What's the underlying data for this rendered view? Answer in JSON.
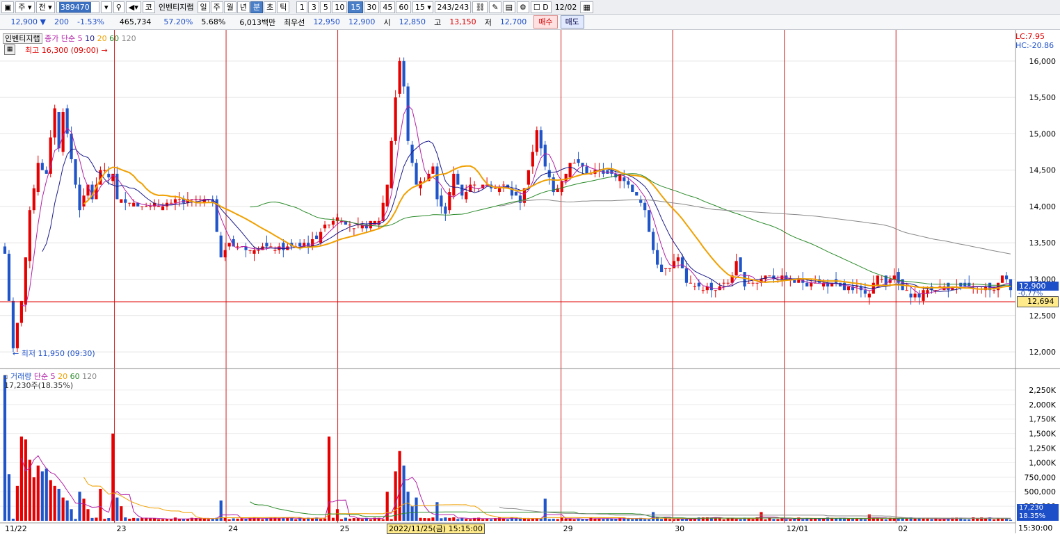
{
  "toolbar": {
    "period_prefix": "주",
    "mode": "전",
    "code": "389470",
    "market_badge": "코",
    "name": "인벤티지랩",
    "periods": [
      "일",
      "주",
      "월",
      "년",
      "분",
      "초",
      "틱"
    ],
    "active_period": "분",
    "intervals": [
      "1",
      "3",
      "5",
      "10",
      "15",
      "30",
      "45",
      "60"
    ],
    "active_interval": "15",
    "interval_select": "15",
    "count": "243/243",
    "date_checkbox": "D",
    "date": "12/02"
  },
  "ticker": {
    "price": "12,900 ▼",
    "change": "200",
    "change_pct": "-1.53%",
    "volume": "465,734",
    "vol_ratio": "57.20%",
    "turnover": "5.68%",
    "amount": "6,013백만",
    "best_label": "최우선",
    "ask": "12,950",
    "bid": "12,900",
    "open_label": "시",
    "open": "12,850",
    "high_label": "고",
    "high": "13,150",
    "low_label": "저",
    "low": "12,700",
    "buy_button": "매수",
    "sell_button": "매도"
  },
  "price_panel": {
    "stock_tag": "인벤티지랩",
    "legend_prefix": "종가 단순",
    "ma_periods": [
      "5",
      "10",
      "20",
      "60",
      "120"
    ],
    "high_annotation": "최고 16,300 (09:00)",
    "low_annotation": "최저 11,950 (09:30)",
    "lc": "LC:7.95",
    "hc": "HC:-20.86",
    "current_price_tag": "12,900",
    "current_change_tag": "-0.77%",
    "crosshair_price_tag": "12,694"
  },
  "volume_panel": {
    "legend_title": "거래량",
    "legend_prefix": "단순",
    "ma_periods": [
      "5",
      "20",
      "60",
      "120"
    ],
    "last_volume": "17,230주(18.35%)",
    "current_volume_tag": "17,230",
    "current_pct_tag": "18.35%"
  },
  "x_axis": {
    "crosshair_label": "2022/11/25(금) 15:15:00",
    "time_label": "15:30:00"
  },
  "colors": {
    "up": "#e60000",
    "down": "#1f55c9",
    "ma5": "#b21fa6",
    "ma10": "#1a1a8a",
    "ma20": "#f0a000",
    "ma60": "#2a8a2a",
    "ma120": "#888888"
  },
  "chart_data": [
    {
      "type": "candlestick",
      "title": "인벤티지랩 15분봉",
      "ylim": [
        11800,
        16400
      ],
      "yticks": [
        12000,
        12500,
        13000,
        13500,
        14000,
        14500,
        15000,
        15500,
        16000
      ],
      "ytick_labels": [
        "12,000",
        "12,500",
        "13,000",
        "13,500",
        "14,000",
        "14,500",
        "15,000",
        "15,500",
        "16,000"
      ],
      "sessions": [
        {
          "label": "11/22",
          "x": 0
        },
        {
          "label": "23",
          "x": 26
        },
        {
          "label": "24",
          "x": 52
        },
        {
          "label": "25",
          "x": 78
        },
        {
          "label": "29",
          "x": 130
        },
        {
          "label": "30",
          "x": 156
        },
        {
          "label": "12/01",
          "x": 182
        },
        {
          "label": "02",
          "x": 208
        }
      ],
      "session_bars": 26,
      "x_count": 243,
      "crosshair_price": 12694,
      "current_price": 12900,
      "anchors": [
        [
          0,
          13350
        ],
        [
          2,
          12050
        ],
        [
          3,
          12400
        ],
        [
          4,
          12700
        ],
        [
          6,
          13900
        ],
        [
          8,
          14600
        ],
        [
          10,
          14450
        ],
        [
          12,
          15350
        ],
        [
          13,
          14800
        ],
        [
          14,
          15300
        ],
        [
          16,
          14650
        ],
        [
          18,
          13950
        ],
        [
          20,
          14300
        ],
        [
          21,
          14100
        ],
        [
          23,
          14500
        ],
        [
          25,
          14400
        ],
        [
          26,
          14450
        ],
        [
          27,
          14100
        ],
        [
          30,
          14050
        ],
        [
          35,
          14000
        ],
        [
          40,
          14050
        ],
        [
          45,
          14100
        ],
        [
          50,
          14050
        ],
        [
          52,
          13300
        ],
        [
          54,
          13500
        ],
        [
          58,
          13400
        ],
        [
          62,
          13450
        ],
        [
          66,
          13400
        ],
        [
          70,
          13450
        ],
        [
          74,
          13500
        ],
        [
          78,
          13800
        ],
        [
          80,
          13850
        ],
        [
          84,
          13700
        ],
        [
          88,
          13750
        ],
        [
          90,
          13800
        ],
        [
          92,
          14300
        ],
        [
          94,
          15500
        ],
        [
          95,
          16000
        ],
        [
          96,
          15650
        ],
        [
          97,
          14900
        ],
        [
          99,
          14300
        ],
        [
          101,
          14400
        ],
        [
          103,
          14550
        ],
        [
          104,
          14100
        ],
        [
          106,
          13900
        ],
        [
          108,
          14450
        ],
        [
          110,
          14150
        ],
        [
          112,
          14300
        ],
        [
          114,
          14250
        ],
        [
          116,
          14300
        ],
        [
          118,
          14250
        ],
        [
          120,
          14300
        ],
        [
          124,
          14050
        ],
        [
          126,
          14450
        ],
        [
          128,
          15050
        ],
        [
          130,
          14550
        ],
        [
          132,
          14200
        ],
        [
          134,
          14350
        ],
        [
          136,
          14600
        ],
        [
          138,
          14600
        ],
        [
          140,
          14450
        ],
        [
          142,
          14500
        ],
        [
          144,
          14450
        ],
        [
          146,
          14450
        ],
        [
          148,
          14400
        ],
        [
          150,
          14300
        ],
        [
          152,
          14150
        ],
        [
          154,
          13950
        ],
        [
          156,
          13400
        ],
        [
          158,
          13100
        ],
        [
          160,
          13200
        ],
        [
          162,
          13300
        ],
        [
          164,
          12950
        ],
        [
          166,
          12900
        ],
        [
          170,
          12850
        ],
        [
          174,
          12950
        ],
        [
          176,
          13200
        ],
        [
          178,
          12950
        ],
        [
          180,
          12950
        ],
        [
          182,
          13000
        ],
        [
          184,
          13050
        ],
        [
          188,
          13000
        ],
        [
          192,
          12950
        ],
        [
          196,
          12950
        ],
        [
          200,
          12900
        ],
        [
          204,
          12850
        ],
        [
          208,
          12850
        ],
        [
          210,
          13050
        ],
        [
          212,
          12950
        ],
        [
          214,
          13050
        ],
        [
          216,
          12850
        ],
        [
          218,
          12800
        ],
        [
          220,
          12750
        ],
        [
          222,
          12850
        ],
        [
          226,
          12900
        ],
        [
          230,
          12900
        ],
        [
          234,
          12900
        ],
        [
          238,
          12850
        ],
        [
          240,
          13050
        ],
        [
          242,
          12900
        ]
      ]
    },
    {
      "type": "bar",
      "title": "거래량",
      "ylim": [
        0,
        2500000
      ],
      "yticks": [
        250000,
        500000,
        750000,
        1000000,
        1250000,
        1500000,
        1750000,
        2000000,
        2250000
      ],
      "ytick_labels": [
        "250,000",
        "500,000",
        "750,000",
        "1,000K",
        "1,250K",
        "1,500K",
        "1,750K",
        "2,000K",
        "2,250K"
      ],
      "spikes": [
        [
          0,
          2500000
        ],
        [
          1,
          800000
        ],
        [
          3,
          600000
        ],
        [
          4,
          1450000
        ],
        [
          5,
          1400000
        ],
        [
          6,
          1050000
        ],
        [
          7,
          750000
        ],
        [
          8,
          950000
        ],
        [
          9,
          850000
        ],
        [
          10,
          900000
        ],
        [
          11,
          700000
        ],
        [
          12,
          600000
        ],
        [
          13,
          550000
        ],
        [
          14,
          400000
        ],
        [
          15,
          350000
        ],
        [
          16,
          200000
        ],
        [
          18,
          500000
        ],
        [
          19,
          380000
        ],
        [
          20,
          200000
        ],
        [
          23,
          550000
        ],
        [
          26,
          1500000
        ],
        [
          27,
          400000
        ],
        [
          28,
          250000
        ],
        [
          52,
          350000
        ],
        [
          78,
          1450000
        ],
        [
          80,
          200000
        ],
        [
          92,
          500000
        ],
        [
          94,
          850000
        ],
        [
          95,
          1200000
        ],
        [
          96,
          950000
        ],
        [
          97,
          500000
        ],
        [
          98,
          250000
        ],
        [
          99,
          400000
        ],
        [
          104,
          320000
        ],
        [
          130,
          380000
        ],
        [
          156,
          150000
        ],
        [
          182,
          150000
        ],
        [
          208,
          110000
        ],
        [
          242,
          50000
        ]
      ],
      "base_volume": 40000,
      "last_volume": 17230
    }
  ]
}
